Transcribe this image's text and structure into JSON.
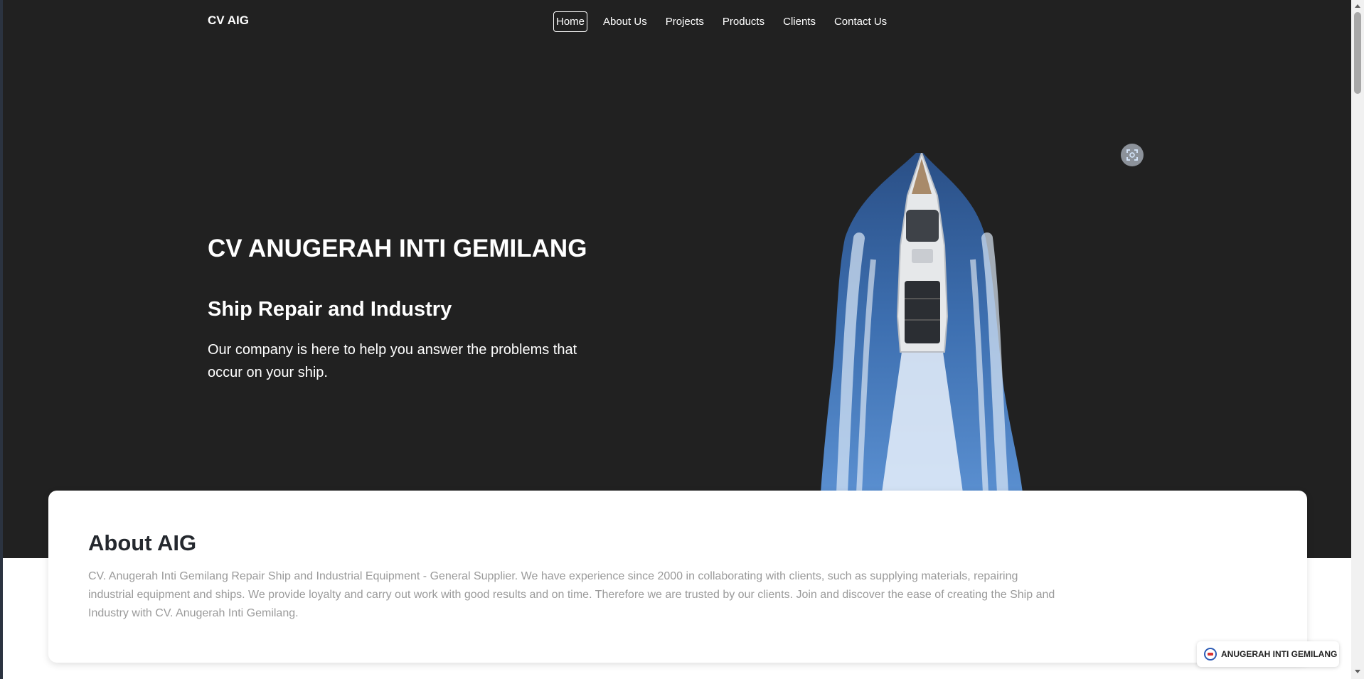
{
  "navbar": {
    "brand": "CV AIG",
    "items": [
      {
        "label": "Home",
        "active": true
      },
      {
        "label": "About Us"
      },
      {
        "label": "Projects"
      },
      {
        "label": "Products"
      },
      {
        "label": "Clients"
      },
      {
        "label": "Contact Us"
      }
    ]
  },
  "hero": {
    "title": "CV ANUGERAH INTI GEMILANG",
    "subtitle": "Ship Repair and Industry",
    "description": "Our company is here to help you answer the problems that occur on your ship.",
    "image": "speedboat-aerial-image",
    "fullscreen_icon": "fullscreen-icon"
  },
  "about": {
    "title": "About AIG",
    "text": "CV. Anugerah Inti Gemilang Repair Ship and Industrial Equipment - General Supplier. We have experience since 2000 in collaborating with clients, such as supplying materials, repairing industrial equipment and ships. We provide loyalty and carry out work with good results and on time. Therefore we are trusted by our clients. Join and discover the ease of creating the Ship and Industry with CV. Anugerah Inti Gemilang."
  },
  "badge": {
    "label": "ANUGERAH INTI GEMILANG",
    "icon": "company-logo-icon"
  },
  "colors": {
    "hero_background": "#212121",
    "page_background": "#ffffff",
    "about_text": "#9a9a9a",
    "heading_dark": "#24282e"
  }
}
